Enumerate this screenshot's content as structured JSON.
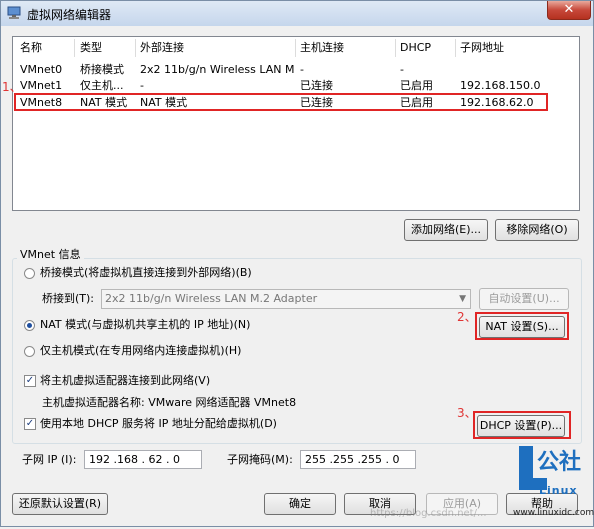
{
  "window": {
    "title": "虚拟网络编辑器",
    "close_glyph": "✕"
  },
  "table": {
    "headers": [
      "名称",
      "类型",
      "外部连接",
      "主机连接",
      "DHCP",
      "子网地址"
    ],
    "rows": [
      {
        "name": "VMnet0",
        "type": "桥接模式",
        "external": "2x2 11b/g/n Wireless LAN M...",
        "host": "-",
        "dhcp": "-",
        "subnet": ""
      },
      {
        "name": "VMnet1",
        "type": "仅主机...",
        "external": "-",
        "host": "已连接",
        "dhcp": "已启用",
        "subnet": "192.168.150.0"
      },
      {
        "name": "VMnet8",
        "type": "NAT 模式",
        "external": "NAT 模式",
        "host": "已连接",
        "dhcp": "已启用",
        "subnet": "192.168.62.0"
      }
    ]
  },
  "buttons": {
    "add_network": "添加网络(E)...",
    "remove_network": "移除网络(O)",
    "auto_settings": "自动设置(U)...",
    "nat_settings": "NAT 设置(S)...",
    "dhcp_settings": "DHCP 设置(P)...",
    "restore_defaults": "还原默认设置(R)",
    "ok": "确定",
    "cancel": "取消",
    "apply": "应用(A)",
    "help": "帮助"
  },
  "vmnet_info": {
    "group_label": "VMnet 信息",
    "bridged_mode": "桥接模式(将虚拟机直接连接到外部网络)(B)",
    "bridged_to_label": "桥接到(T):",
    "bridged_to_value": "2x2 11b/g/n Wireless LAN M.2 Adapter",
    "nat_mode": "NAT 模式(与虚拟机共享主机的 IP 地址)(N)",
    "host_only_mode": "仅主机模式(在专用网络内连接虚拟机)(H)",
    "connect_host_adapter": "将主机虚拟适配器连接到此网络(V)",
    "host_adapter_name": "主机虚拟适配器名称: VMware 网络适配器 VMnet8",
    "use_dhcp": "使用本地 DHCP 服务将 IP 地址分配给虚拟机(D)",
    "subnet_ip_label": "子网 IP (I):",
    "subnet_ip_value": "192 .168 . 62 . 0",
    "subnet_mask_label": "子网掩码(M):",
    "subnet_mask_value": "255 .255 .255 . 0"
  },
  "annotations": {
    "one": "1、",
    "two": "2、",
    "three": "3、"
  },
  "watermark": {
    "logo": "公社",
    "brand": "Linux",
    "url": "www.linuxidc.com",
    "faint_url": "https://blog.csdn.net/..."
  },
  "colors": {
    "highlight_red": "#e02525",
    "brand_blue": "#1e6fbf"
  }
}
